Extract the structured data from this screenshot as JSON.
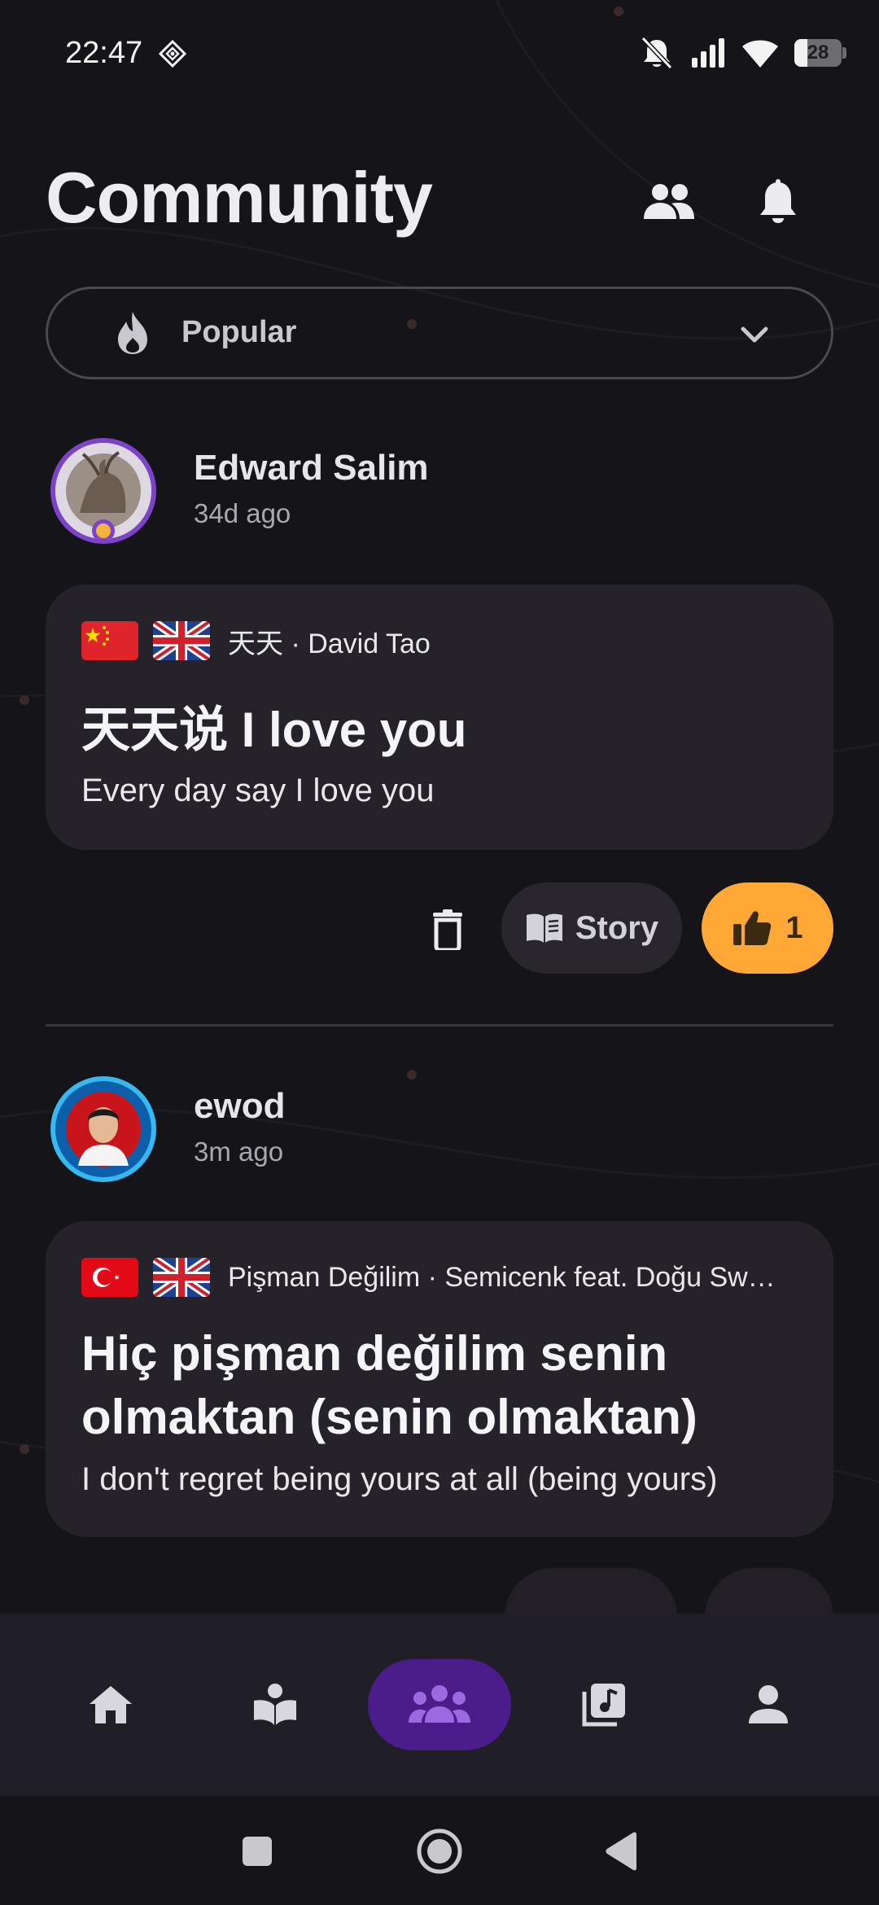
{
  "status_bar": {
    "time": "22:47",
    "battery_level": "28",
    "battery_fraction": 0.28
  },
  "header": {
    "title": "Community",
    "friends_icon": "people-icon",
    "notifications_icon": "bell-icon"
  },
  "filter": {
    "selected": "Popular",
    "icon": "flame-icon"
  },
  "posts": [
    {
      "user": "Edward Salim",
      "time": "34d ago",
      "source_flag": "CN",
      "target_flag": "GB",
      "song_info": "天天 · David Tao",
      "original": "天天说 I love you",
      "translation": "Every day say I love you",
      "story_label": "Story",
      "likes": "1"
    },
    {
      "user": "ewod",
      "time": "3m ago",
      "source_flag": "TR",
      "target_flag": "GB",
      "song_info": "Pişman Değilim · Semicenk feat. Doğu Sw…",
      "original_line1": "Hiç pişman değilim senin",
      "original_line2": "olmaktan (senin olmaktan)",
      "translation": "I don't regret being yours at all (being yours)"
    }
  ],
  "bottom_nav": {
    "items": [
      "home-icon",
      "learn-icon",
      "community-icon",
      "music-library-icon",
      "profile-icon"
    ],
    "active": "community-icon",
    "active_color": "#4b1d8a"
  },
  "colors": {
    "background": "#151418",
    "card": "#252329",
    "like_accent": "#ffa836"
  }
}
